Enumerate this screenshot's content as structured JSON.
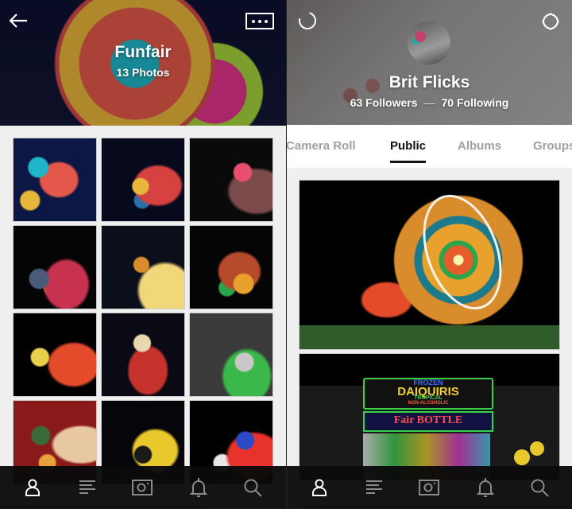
{
  "left_panel": {
    "header": {
      "back_icon": "arrow-left-icon",
      "more_icon": "ellipsis-icon",
      "title": "Funfair",
      "subtitle": "13 Photos"
    },
    "photos": [
      {
        "desc": "Ferris wheel at night",
        "colors": [
          "#0d1745",
          "#e3584b",
          "#1fb6c9",
          "#e8b63a"
        ]
      },
      {
        "desc": "Spinning wheel blur",
        "colors": [
          "#07091c",
          "#d6423f",
          "#e8b63a",
          "#2b6fa8"
        ]
      },
      {
        "desc": "Saucer ride",
        "colors": [
          "#0a0a0a",
          "#7b4a4a",
          "#e84e6e",
          "#c8c8c8"
        ]
      },
      {
        "desc": "Tower ride blur",
        "colors": [
          "#050505",
          "#c8324e",
          "#4a5a7a",
          "#e8d04a"
        ]
      },
      {
        "desc": "Swing carousel",
        "colors": [
          "#0a0f1a",
          "#f2d77a",
          "#d98c2c",
          "#1e2a4a"
        ]
      },
      {
        "desc": "Tent ride",
        "colors": [
          "#050505",
          "#b84a2c",
          "#e8a12c",
          "#2aa54b"
        ]
      },
      {
        "desc": "Pendulum ride",
        "colors": [
          "#000000",
          "#e34b2b",
          "#e8d04a",
          "#4ab8c8"
        ]
      },
      {
        "desc": "Carousel crowd",
        "colors": [
          "#0a0a14",
          "#c8322c",
          "#e8d8b0",
          "#3a3a3a"
        ]
      },
      {
        "desc": "Elephant ride",
        "colors": [
          "#3a3a3a",
          "#3ab84a",
          "#c8c8c8",
          "#6a5a7a"
        ]
      },
      {
        "desc": "Carousel horse",
        "colors": [
          "#8a1a1a",
          "#e8c8a0",
          "#3a6a3a",
          "#e8a03a"
        ]
      },
      {
        "desc": "Bee ride",
        "colors": [
          "#05050a",
          "#e8c82a",
          "#1a1a1a",
          "#d8d8e8"
        ]
      },
      {
        "desc": "Tower lights",
        "colors": [
          "#000000",
          "#e8322c",
          "#2a4ac8",
          "#e8e8e8"
        ]
      }
    ]
  },
  "right_panel": {
    "header": {
      "refresh_icon": "refresh-icon",
      "settings_icon": "gear-icon",
      "name": "Brit Flicks",
      "followers": "63 Followers",
      "separator": "—",
      "following": "70 Following"
    },
    "tabs": [
      {
        "label": "Camera Roll",
        "active": false
      },
      {
        "label": "Public",
        "active": true
      },
      {
        "label": "Albums",
        "active": false
      },
      {
        "label": "Groups",
        "active": false
      }
    ],
    "feed": [
      {
        "desc": "Spinning ride long exposure"
      },
      {
        "desc": "Frozen daiquiris stand",
        "sign_lines": [
          "FROZEN",
          "DAIQUIRIS",
          "TROPICAL",
          "NON-ALCOHOLIC"
        ],
        "banner": "Fair BOTTLE"
      }
    ]
  },
  "tabbar": {
    "items": [
      {
        "name": "profile",
        "icon": "person-icon",
        "active": true
      },
      {
        "name": "feed",
        "icon": "list-icon",
        "active": false
      },
      {
        "name": "camera",
        "icon": "camera-icon",
        "active": false
      },
      {
        "name": "notifications",
        "icon": "bell-icon",
        "active": false
      },
      {
        "name": "search",
        "icon": "search-icon",
        "active": false
      }
    ],
    "active_color": "#ffffff",
    "inactive_color": "#8a8a8a"
  }
}
